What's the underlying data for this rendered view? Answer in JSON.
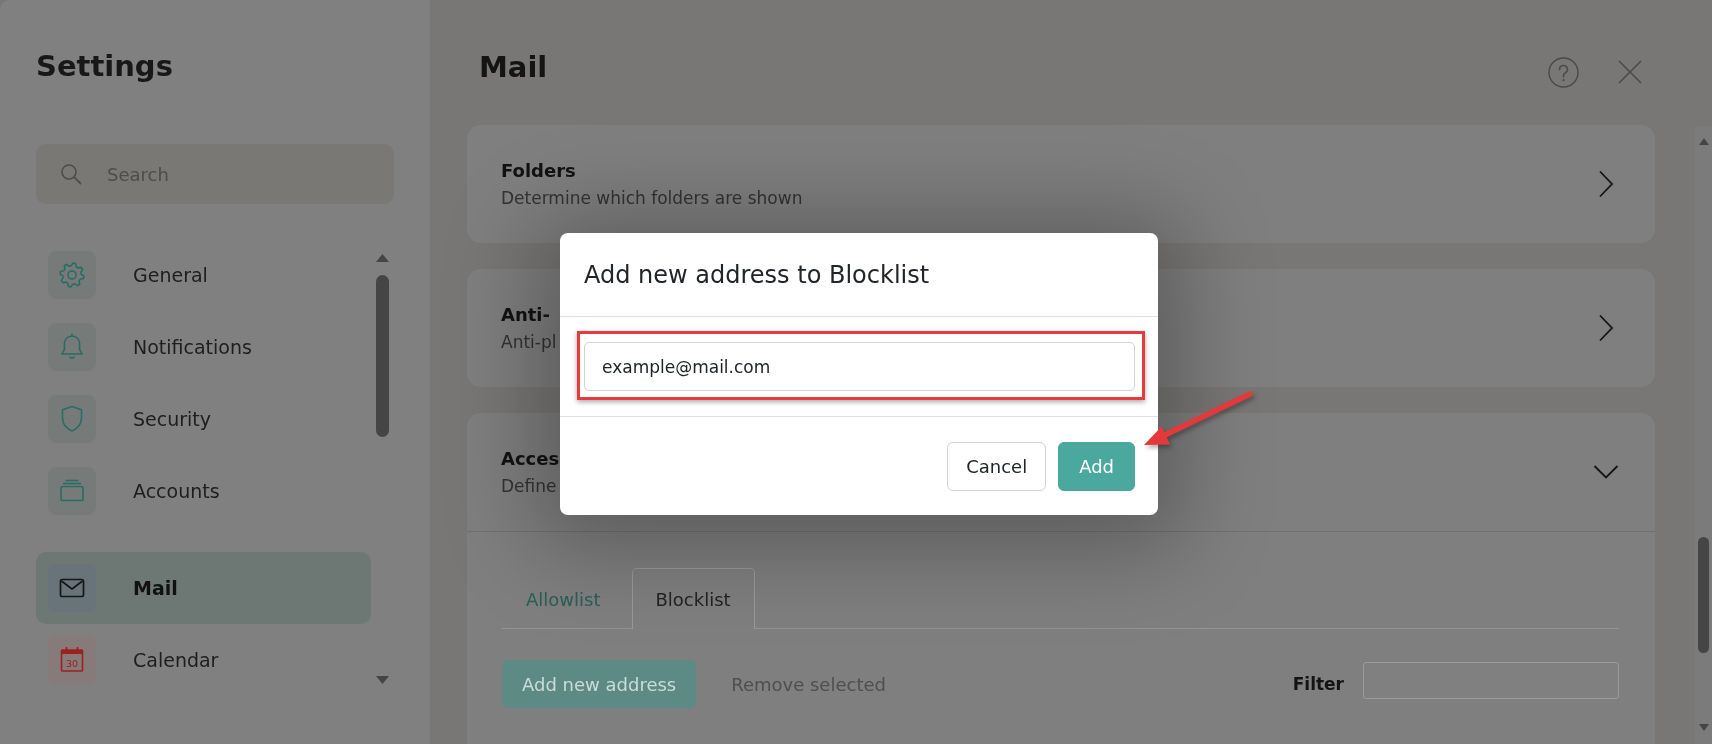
{
  "sidebar": {
    "title": "Settings",
    "search": {
      "placeholder": "Search"
    },
    "groups": [
      {
        "items": [
          {
            "label": "General",
            "selected": false
          },
          {
            "label": "Notifications",
            "selected": false
          },
          {
            "label": "Security",
            "selected": false
          },
          {
            "label": "Accounts",
            "selected": false
          }
        ]
      },
      {
        "items": [
          {
            "label": "Mail",
            "selected": true
          },
          {
            "label": "Calendar",
            "selected": false,
            "icon_label": "30"
          }
        ]
      }
    ]
  },
  "page": {
    "title": "Mail"
  },
  "sections": [
    {
      "title": "Folders",
      "subtitle": "Determine which folders are shown",
      "expanded": false
    },
    {
      "title": "Anti-",
      "subtitle": "Anti-pl",
      "expanded": false
    },
    {
      "title": "Acces",
      "subtitle": "Define",
      "expanded": true,
      "tabs": [
        {
          "label": "Allowlist",
          "selected": false
        },
        {
          "label": "Blocklist",
          "selected": true
        }
      ],
      "toolbar": {
        "buttons": [
          {
            "label": "Add new address",
            "kind": "primary"
          },
          {
            "label": "Remove selected",
            "kind": "link"
          }
        ],
        "filter": {
          "label": "Filter"
        }
      }
    }
  ],
  "dialog": {
    "title": "Add new address to Blocklist",
    "input": {
      "value": "example@mail.com"
    },
    "buttons": [
      {
        "label": "Cancel",
        "kind": "secondary"
      },
      {
        "label": "Add",
        "kind": "primary"
      }
    ]
  }
}
